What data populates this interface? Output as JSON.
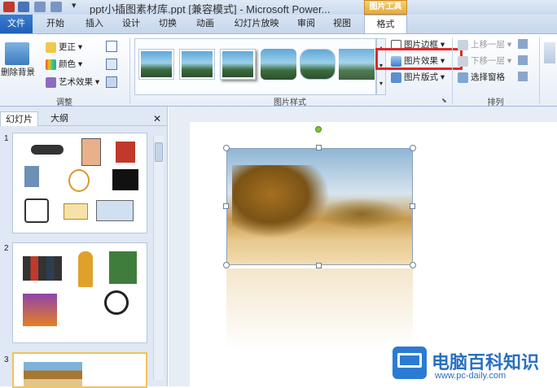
{
  "window": {
    "title": "ppt小插图素材库.ppt [兼容模式] - Microsoft Power...",
    "context_tab_header": "图片工具"
  },
  "tabs": [
    "文件",
    "开始",
    "插入",
    "设计",
    "切换",
    "动画",
    "幻灯片放映",
    "审阅",
    "视图",
    "格式"
  ],
  "ribbon": {
    "adjust": {
      "remove_bg": "删除背景",
      "correct": "更正 ▾",
      "color": "颜色 ▾",
      "artistic": "艺术效果 ▾",
      "label": "调整"
    },
    "styles": {
      "label": "图片样式",
      "border": "图片边框 ▾",
      "effects": "图片效果 ▾",
      "layout": "图片版式 ▾"
    },
    "arrange": {
      "label": "排列",
      "bring_forward": "上移一层 ▾",
      "send_backward": "下移一层 ▾",
      "selection_pane": "选择窗格"
    }
  },
  "left_pane": {
    "tab_slides": "幻灯片",
    "tab_outline": "大纲",
    "close": "✕",
    "slide_numbers": [
      "1",
      "2",
      "3"
    ]
  },
  "watermark": {
    "brand": "电脑百科知识",
    "url": "www.pc-daily.com"
  },
  "colors": {
    "accent": "#2b6cc4",
    "highlight": "#e12727",
    "context": "#e8a93a"
  }
}
